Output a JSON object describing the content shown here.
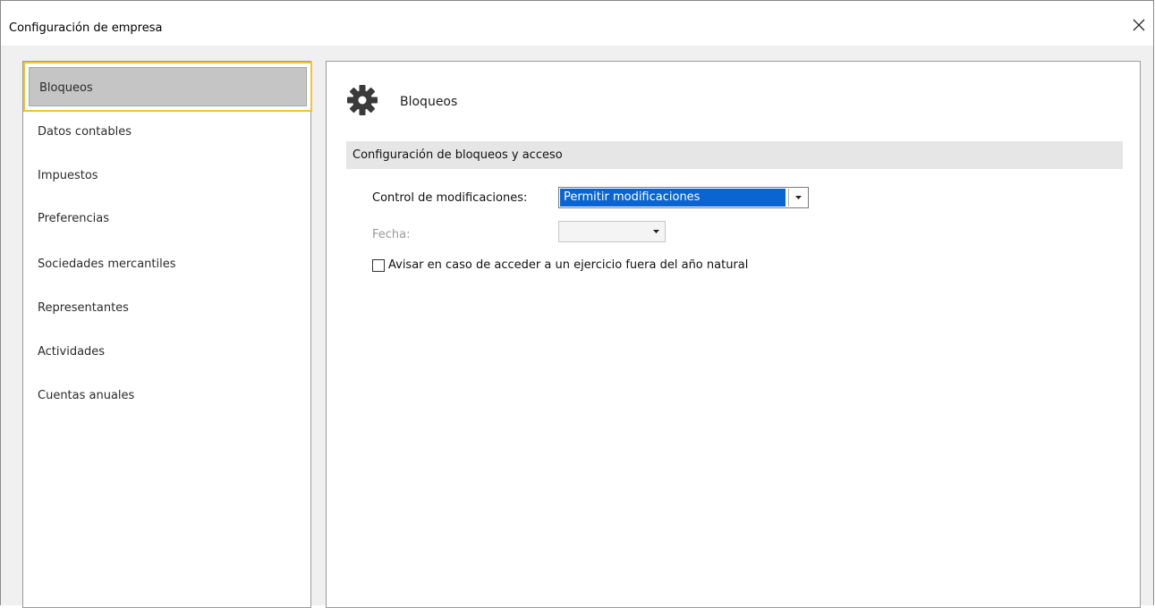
{
  "window": {
    "title": "Configuración de empresa"
  },
  "sidebar": {
    "items": [
      {
        "label": "Bloqueos",
        "selected": true
      },
      {
        "label": "Datos contables"
      },
      {
        "label": "Impuestos"
      },
      {
        "label": "Preferencias"
      },
      {
        "label": "Sociedades mercantiles"
      },
      {
        "label": "Representantes"
      },
      {
        "label": "Actividades"
      },
      {
        "label": "Cuentas anuales"
      }
    ]
  },
  "main": {
    "section_title": "Bloqueos",
    "section_icon": "gear-icon",
    "group_header": "Configuración de bloqueos y acceso",
    "control_label": "Control de modificaciones:",
    "control_value": "Permitir modificaciones",
    "fecha_label": "Fecha:",
    "fecha_value": "",
    "checkbox_label": "Avisar en caso de acceder a un ejercicio fuera del año natural",
    "checkbox_checked": false
  },
  "colors": {
    "selection_highlight": "#0a64d2",
    "focus_border": "#f5c230",
    "selected_item_bg": "#c5c5c5",
    "group_header_bg": "#e6e6e6"
  }
}
